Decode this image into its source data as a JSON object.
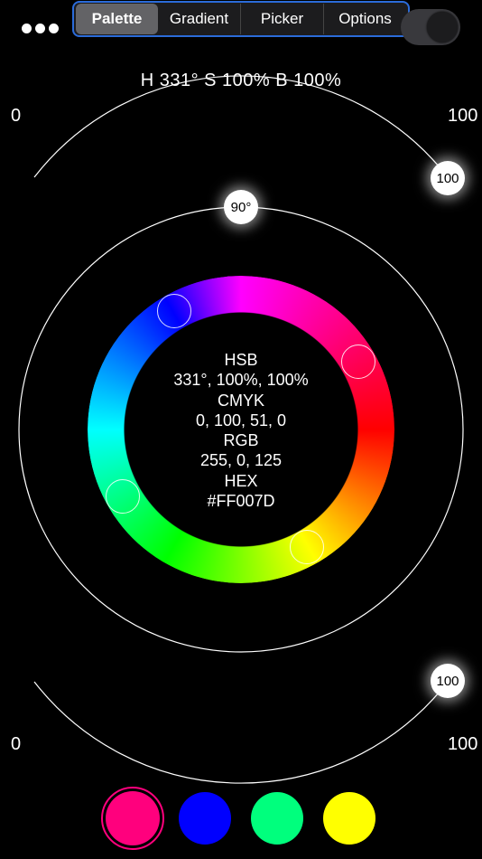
{
  "menu_icon": "more-horizontal-icon",
  "tabs": [
    {
      "label": "Palette",
      "active": true
    },
    {
      "label": "Gradient",
      "active": false
    },
    {
      "label": "Picker",
      "active": false
    },
    {
      "label": "Options",
      "active": false
    }
  ],
  "toggle": {
    "on": true
  },
  "hsb_readout": "H 331°  S 100%  B 100%",
  "saturation_arc": {
    "min_label": "0",
    "max_label": "100",
    "value_label": "100"
  },
  "brightness_arc": {
    "min_label": "0",
    "max_label": "100",
    "value_label": "100"
  },
  "angle_knob": {
    "label": "90°"
  },
  "color_info": {
    "hsb_title": "HSB",
    "hsb_value": "331°, 100%, 100%",
    "cmyk_title": "CMYK",
    "cmyk_value": "0, 100, 51, 0",
    "rgb_title": "RGB",
    "rgb_value": "255, 0, 125",
    "hex_title": "HEX",
    "hex_value": "#FF007D"
  },
  "swatches": [
    {
      "color": "#FF007D",
      "selected": true
    },
    {
      "color": "#0000FF",
      "selected": false
    },
    {
      "color": "#00FF7D",
      "selected": false
    },
    {
      "color": "#FFFF00",
      "selected": false
    }
  ],
  "accent_color": "#2B6BD9"
}
